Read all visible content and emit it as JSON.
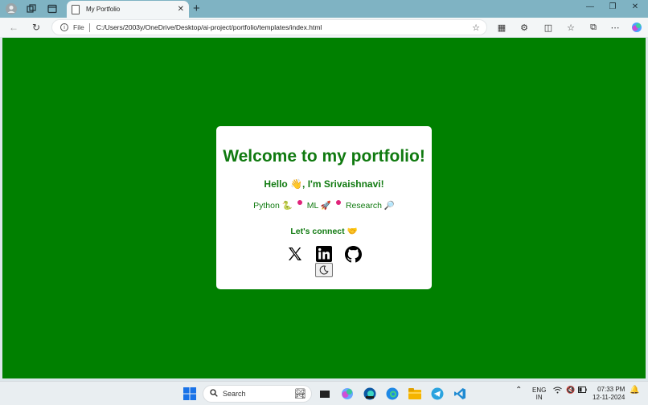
{
  "browser": {
    "tab_title": "My Portfolio",
    "address_scheme": "File",
    "url": "C:/Users/2003y/OneDrive/Desktop/ai-project/portfolio/templates/index.html"
  },
  "page": {
    "background_color": "#008000",
    "heading": "Welcome to my portfolio!",
    "hello": "Hello 👋, I'm Srivaishnavi!",
    "skills": [
      "Python 🐍",
      "ML 🚀",
      "Research 🔎"
    ],
    "connect": "Let's connect 🤝",
    "socials": [
      "x-icon",
      "linkedin-icon",
      "github-icon"
    ],
    "theme_toggle_icon": "moon-icon"
  },
  "taskbar": {
    "search_placeholder": "Search",
    "lang_top": "ENG",
    "lang_bottom": "IN",
    "time": "07:33 PM",
    "date": "12-11-2024"
  }
}
